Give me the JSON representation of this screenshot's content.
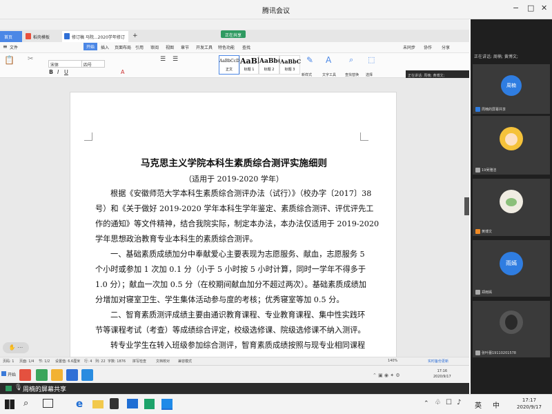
{
  "window": {
    "title": "腾讯会议",
    "controls": {
      "minimize": "−",
      "maximize": "□",
      "close": "✕"
    }
  },
  "wps": {
    "tabs": [
      {
        "label": "首页"
      },
      {
        "label": "稻壳模板"
      },
      {
        "label": "修订稿 马院...2020学年修订"
      }
    ],
    "add_tab": "+",
    "sharing_pill": "正在共享",
    "menu": [
      "文件",
      "开始",
      "插入",
      "页面布局",
      "引用",
      "审阅",
      "视图",
      "章节",
      "开发工具",
      "特色功能",
      "查找"
    ],
    "menu_right": [
      "未同步",
      "协作",
      "分享"
    ],
    "font_name": "宋体",
    "font_size": "四号",
    "styles": [
      {
        "sample": "AaBbCcDd",
        "name": "正文"
      },
      {
        "sample": "AaBl",
        "name": "标题 1"
      },
      {
        "sample": "AaBb(",
        "name": "标题 2"
      },
      {
        "sample": "AaBbC",
        "name": "标题 3"
      }
    ],
    "tools": [
      "新样式",
      "文字工具",
      "查找替换",
      "选择"
    ],
    "status": {
      "page_num": "页码: 1",
      "pages": "页面: 1/4",
      "section": "节: 1/2",
      "settings": "设置值: 6.6厘米",
      "row": "行: 4",
      "col": "列: 22",
      "word_count": "字数: 1876",
      "spell_check": "拼写检查",
      "doc_check": "文档校对",
      "compat": "兼容模式",
      "zoom": "140%",
      "backup": "实时备份更新"
    }
  },
  "document": {
    "title": "马克思主义学院本科生素质综合测评实施细则",
    "subtitle": "（适用于 2019-2020 学年）",
    "lines": [
      "根据《安徽师范大学本科生素质综合测评办法（试行）》（校办字〔2017〕38",
      "号）和《关于做好 2019-2020 学年本科生学年鉴定、素质综合测评、评优评先工",
      "作的通知》等文件精神，结合我院实际，制定本办法，本办法仅适用于 2019-2020",
      "学年思想政治教育专业本科生的素质综合测评。",
      "一、基础素质成绩加分中奉献爱心主要表现为志愿服务、献血，志愿服务 5",
      "个小时或参加 1 次加 0.1 分（小于 5 小时按 5 小时计算，同时一学年不得多于",
      "1.0 分）；献血一次加 0.5 分（在校期间献血加分不超过两次）。基础素质成绩加",
      "分增加对寝室卫生、学生集体活动参与度的考核；优秀寝室等加 0.5 分。",
      "二、智育素质测评成绩主要由通识教育课程、专业教育课程、集中性实践环",
      "节等课程考试（考查）等成绩综合评定，校级选修课、院级选修课不纳入测评。",
      "转专业学生在转入班级参加综合测评，智育素质成绩按照与现专业相同课程"
    ]
  },
  "meeting": {
    "speaking_panel": "正在讲话: 周楠; 黄博文;",
    "floating_speaking": "正在讲话: 周楠; 黄博文;",
    "floating_name": "周楠",
    "floating_avatar_text": "周楠",
    "participants": [
      {
        "name": "周楠的屏幕共享",
        "avatar_text": "周楠",
        "avatar_color": "#2f7de1"
      },
      {
        "name": "19吴雅洁",
        "avatar_text": "",
        "avatar_color": "#f5c23a"
      },
      {
        "name": "黄博文",
        "avatar_text": "",
        "avatar_color": "#f0ece2"
      },
      {
        "name": "郑雨嫣",
        "avatar_text": "雨嫣",
        "avatar_color": "#2f7de1"
      },
      {
        "name": "张叶蕾19110201578",
        "avatar_text": "",
        "avatar_color": "#555555"
      }
    ],
    "share_bar_text": "周楠的屏幕共享"
  },
  "inner_taskbar": {
    "start_label": "开始",
    "time": "17:16",
    "date": "2020/9/17"
  },
  "taskbar": {
    "time": "17:17",
    "date": "2020/9/17",
    "lang": "英",
    "input_mode": "中"
  },
  "colors": {
    "accent_blue": "#2f7de1",
    "wps_tab_blue": "#4b87e6",
    "share_green": "#2f9a61",
    "panel_dark": "#1f1f1f"
  }
}
